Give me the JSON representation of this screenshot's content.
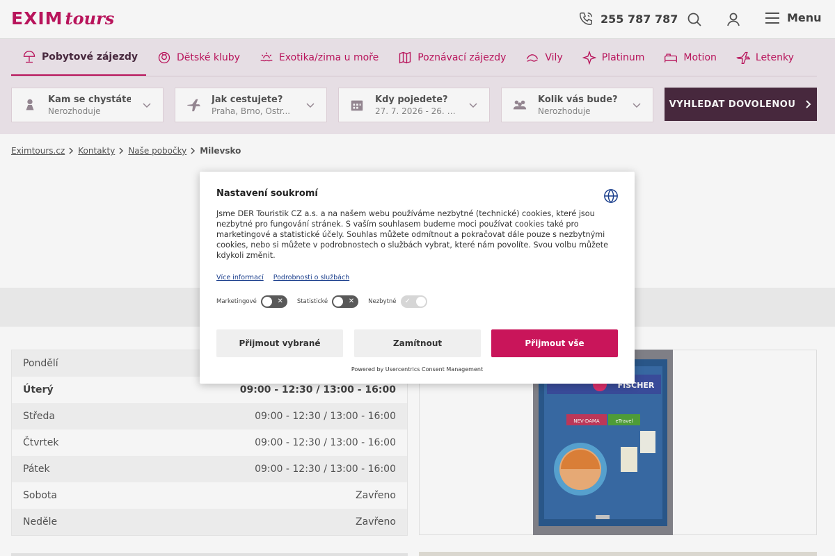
{
  "header": {
    "logo_main": "EXIM",
    "logo_sub": "tours",
    "phone": "255 787 787",
    "menu_label": "Menu"
  },
  "tabs": [
    {
      "label": "Pobytové zájezdy",
      "icon": "beach-umbrella-icon",
      "active": true
    },
    {
      "label": "Dětské kluby",
      "icon": "kids-club-icon"
    },
    {
      "label": "Exotika/zima u moře",
      "icon": "sun-waves-icon"
    },
    {
      "label": "Poznávací zájezdy",
      "icon": "map-icon"
    },
    {
      "label": "Vily",
      "icon": "villa-icon"
    },
    {
      "label": "Platinum",
      "icon": "sparkle-icon"
    },
    {
      "label": "Motion",
      "icon": "bed-icon"
    },
    {
      "label": "Letenky",
      "icon": "plane-icon"
    }
  ],
  "search": {
    "destination": {
      "label": "Kam se chystáte?",
      "value": "Nerozhoduje"
    },
    "departure": {
      "label": "Jak cestujete?",
      "value": "Praha, Brno, Ostr..."
    },
    "dates": {
      "label": "Kdy pojedete?",
      "value": "27. 7. 2026 - 26. 9...."
    },
    "travelers": {
      "label": "Kolik vás bude?",
      "value": "Nerozhoduje"
    },
    "submit": "VYHLEDAT DOVOLENOU"
  },
  "breadcrumb": {
    "items": [
      "Eximtours.cz",
      "Kontakty",
      "Naše pobočky"
    ],
    "current": "Milevsko"
  },
  "hours": [
    {
      "day": "Pondělí",
      "time": ""
    },
    {
      "day": "Úterý",
      "time": "09:00 - 12:30 / 13:00 - 16:00",
      "today": true
    },
    {
      "day": "Středa",
      "time": "09:00 - 12:30 / 13:00 - 16:00"
    },
    {
      "day": "Čtvrtek",
      "time": "09:00 - 12:30 / 13:00 - 16:00"
    },
    {
      "day": "Pátek",
      "time": "09:00 - 12:30 / 13:00 - 16:00"
    },
    {
      "day": "Sobota",
      "time": "Zavřeno"
    },
    {
      "day": "Neděle",
      "time": "Zavřeno"
    }
  ],
  "photo": {
    "sign_text": "FISCHER",
    "sticker_1": "NEV-DAMA",
    "sticker_2": "eTravel"
  },
  "consent": {
    "title": "Nastavení soukromí",
    "text": "Jsme DER Touristik CZ a.s. a na našem webu používáme nezbytné (technické) cookies, které jsou nezbytné pro fungování stránek. S vaším souhlasem budeme moci používat cookies také pro marketingové a statistické účely. Souhlas můžete odmítnout a pokračovat dále pouze s nezbytnými cookies, nebo si můžete v podrobnostech o službách vybrat, které nám povolíte. Svou volbu můžete kdykoli změnit.",
    "link_more": "Více informací",
    "link_details": "Podrobnosti o službách",
    "toggles": [
      {
        "label": "Marketingové",
        "state": "off"
      },
      {
        "label": "Statistické",
        "state": "off"
      },
      {
        "label": "Nezbytné",
        "state": "on"
      }
    ],
    "btn_accept_selected": "Přijmout vybrané",
    "btn_reject": "Zamítnout",
    "btn_accept_all": "Přijmout vše",
    "powered": "Powered by Usercentrics Consent Management"
  },
  "colors": {
    "brand": "#c0155f",
    "dark": "#4a2a40",
    "band": "#f0e8ee",
    "accept": "#c9155a"
  }
}
